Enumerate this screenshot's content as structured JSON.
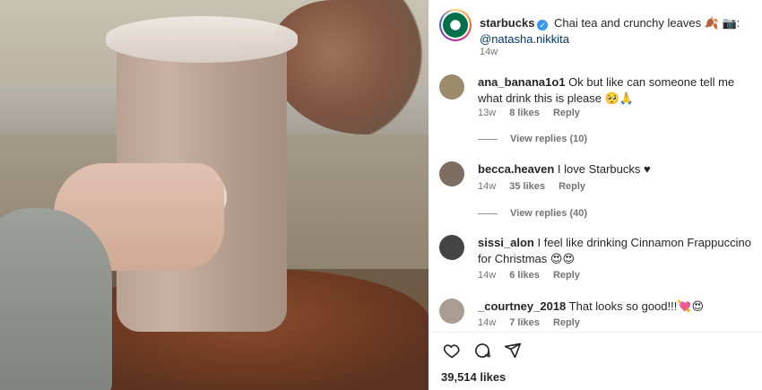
{
  "post": {
    "account": "starbucks",
    "verified_glyph": "✓",
    "caption": "Chai tea and crunchy leaves 🍂 📷:",
    "mention": "@natasha.nikkita",
    "time": "14w"
  },
  "comments": [
    {
      "user": "ana_banana1o1",
      "text": "Ok but like can someone tell me what drink this is please 🥺🙏",
      "time": "13w",
      "likes": "8 likes",
      "reply": "Reply",
      "view_replies": "View replies (10)",
      "avatar_color": "#9b8a6b"
    },
    {
      "user": "becca.heaven",
      "text": "I love Starbucks ♥",
      "time": "14w",
      "likes": "35 likes",
      "reply": "Reply",
      "view_replies": "View replies (40)",
      "avatar_color": "#7e6d61"
    },
    {
      "user": "sissi_alon",
      "text": "I feel like drinking Cinnamon Frappuccino for Christmas 😍😍",
      "time": "14w",
      "likes": "6 likes",
      "reply": "Reply",
      "avatar_color": "#444444"
    },
    {
      "user": "_courtney_2018",
      "text": "That looks so good!!!💘😍",
      "time": "14w",
      "likes": "7 likes",
      "reply": "Reply",
      "avatar_color": "#a99c91"
    }
  ],
  "actions": {
    "like_icon": "heart-icon",
    "comment_icon": "comment-icon",
    "share_icon": "share-icon",
    "likes_count": "39,514 likes"
  },
  "colors": {
    "link": "#00376b",
    "muted": "#737373",
    "verified": "#3897f0",
    "starbucks_green": "#00704A"
  }
}
